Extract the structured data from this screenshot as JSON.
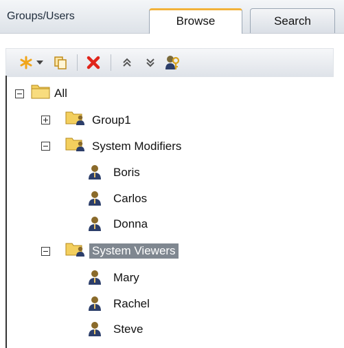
{
  "header": {
    "title": "Groups/Users"
  },
  "tabs": [
    {
      "label": "Browse",
      "active": true
    },
    {
      "label": "Search",
      "active": false
    }
  ],
  "toolbar": {
    "icons": [
      "new-asterisk-icon",
      "dropdown-arrow-icon",
      "copy-icon",
      "delete-x-icon",
      "expand-all-icon",
      "collapse-all-icon",
      "permissions-key-icon"
    ]
  },
  "tree": {
    "root": "All",
    "group1": "Group1",
    "system_modifiers": "System Modifiers",
    "modifiers_users": [
      "Boris",
      "Carlos",
      "Donna"
    ],
    "system_viewers": "System Viewers",
    "viewers_users": [
      "Mary",
      "Rachel",
      "Steve"
    ]
  },
  "colors": {
    "accent_tab": "#f2b23a",
    "selection": "#7f8790",
    "delete": "#e0251b"
  }
}
